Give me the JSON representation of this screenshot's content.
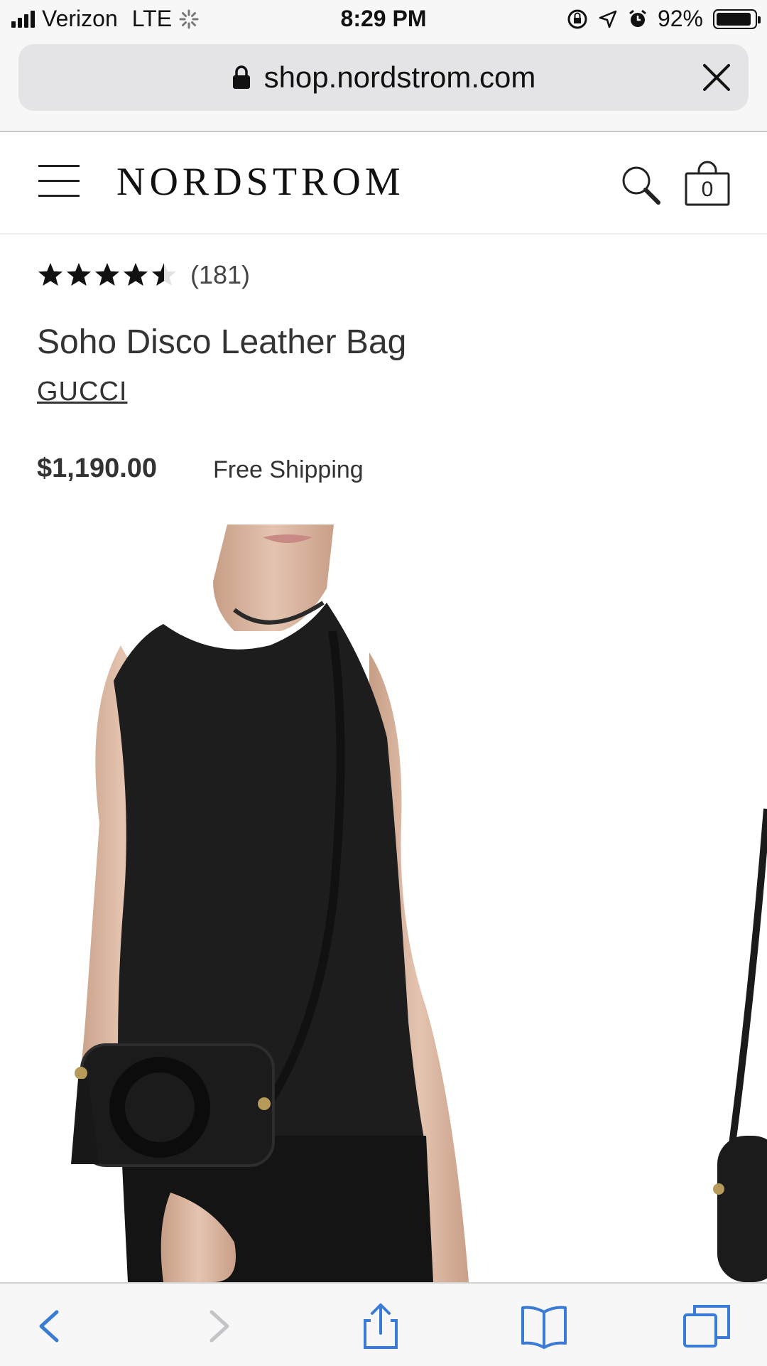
{
  "status_bar": {
    "carrier": "Verizon",
    "network": "LTE",
    "time": "8:29 PM",
    "battery_percent": "92%",
    "battery_level": 0.92
  },
  "browser": {
    "url": "shop.nordstrom.com"
  },
  "header": {
    "logo": "NORDSTROM",
    "bag_count": "0"
  },
  "product": {
    "rating": 4.5,
    "review_count": "(181)",
    "title": "Soho Disco Leather Bag",
    "brand": "GUCCI",
    "price": "$1,190.00",
    "shipping": "Free Shipping"
  },
  "colors": {
    "toolbar_accent": "#3a7bd5",
    "toolbar_disabled": "#c4c4c8"
  }
}
